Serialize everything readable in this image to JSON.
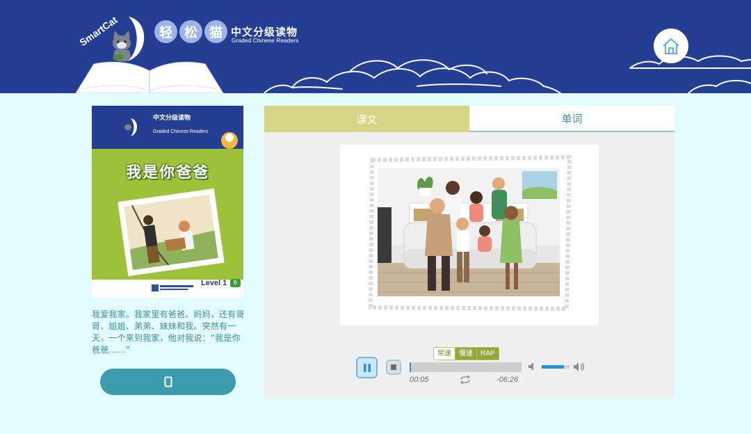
{
  "header": {
    "logo_text": "SmartCat",
    "brand_chars": [
      "轻",
      "松",
      "猫"
    ],
    "brand_cn": "中文分级读物",
    "brand_en": "Graded Chinese Readers",
    "colors": {
      "header_bg": "#243e94",
      "page_bg": "#e3fcfd"
    }
  },
  "home_button": {
    "icon": "home-icon"
  },
  "book": {
    "cover_brand_cn": "中文分级读物",
    "cover_brand_en": "Graded Chinese Readers",
    "cover_title": "我是你爸爸",
    "cover_level": "Level 1",
    "cover_level_number": "6",
    "summary": "我爱我家。我家里有爸爸、妈妈，还有哥哥、姐姐、弟弟、妹妹和我。突然有一天，一个来到我家，他对我说：“我是你爸爸……”",
    "phone_button_icon": "phone-icon"
  },
  "tabs": [
    {
      "label": "课文",
      "active": true
    },
    {
      "label": "单词",
      "active": false
    }
  ],
  "player": {
    "speeds": [
      "常速",
      "慢速",
      "RAP"
    ],
    "current_time": "00:05",
    "remaining_time": "-06:26",
    "progress": 0.013,
    "volume": 0.8,
    "accent": "#2a91d6"
  }
}
